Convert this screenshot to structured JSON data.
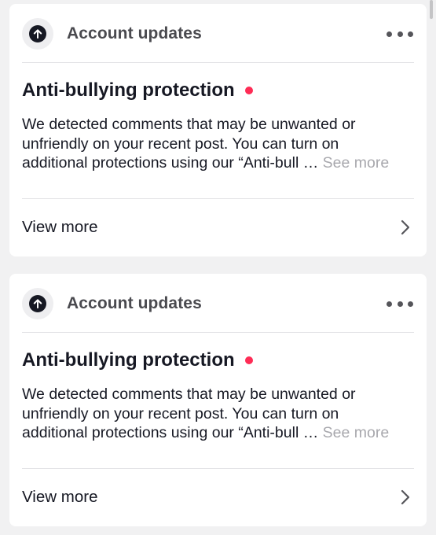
{
  "notifications": [
    {
      "category": "Account updates",
      "title": "Anti-bullying protection",
      "body_lines": [
        "We detected comments that may be unwanted or",
        "unfriendly on your recent post. You can turn on",
        "additional protections using our “Anti-bull … "
      ],
      "see_more": "See more",
      "view_more": "View more",
      "unread": true
    },
    {
      "category": "Account updates",
      "title": "Anti-bullying protection",
      "body_lines": [
        "We detected comments that may be unwanted or",
        "unfriendly on your recent post. You can turn on",
        "additional protections using our “Anti-bull … "
      ],
      "see_more": "See more",
      "view_more": "View more",
      "unread": true
    }
  ],
  "icons": {
    "category": "arrow-up-circle-icon",
    "more": "more-horizontal-icon",
    "chevron": "chevron-right-icon"
  },
  "colors": {
    "background": "#f1f1f2",
    "card": "#ffffff",
    "unread_dot": "#fe2c55",
    "see_more": "#a8a8ad",
    "text": "#161823"
  }
}
